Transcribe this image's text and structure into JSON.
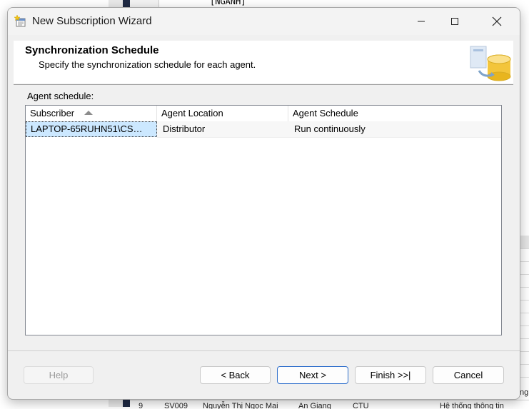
{
  "background": {
    "top_text": "[NGANH]",
    "bottom_row": [
      "9",
      "SV009",
      "Nguyễn Thị Ngọc Mai",
      "An Giang",
      "CTU",
      "Hệ thống thông tin"
    ],
    "side_text": "ng"
  },
  "window": {
    "title": "New Subscription Wizard",
    "minimize_glyph": "—",
    "maximize_glyph": "☐",
    "close_glyph": "✕"
  },
  "page_header": {
    "title": "Synchronization Schedule",
    "subtitle": "Specify the synchronization schedule for each agent."
  },
  "agent_schedule": {
    "label": "Agent schedule:",
    "columns": [
      "Subscriber",
      "Agent Location",
      "Agent Schedule"
    ],
    "sorted_column": "Subscriber",
    "sort_direction": "ascending",
    "rows": [
      {
        "subscriber": "LAPTOP-65RUHN51\\CS…",
        "location": "Distributor",
        "schedule": "Run continuously"
      }
    ]
  },
  "buttons": {
    "help": "Help",
    "back": "< Back",
    "next": "Next >",
    "finish": "Finish >>|",
    "cancel": "Cancel"
  },
  "colors": {
    "selection": "#cce8ff",
    "default_button_border": "#2f6fcc",
    "dialog_bg": "#f0f0f0"
  }
}
